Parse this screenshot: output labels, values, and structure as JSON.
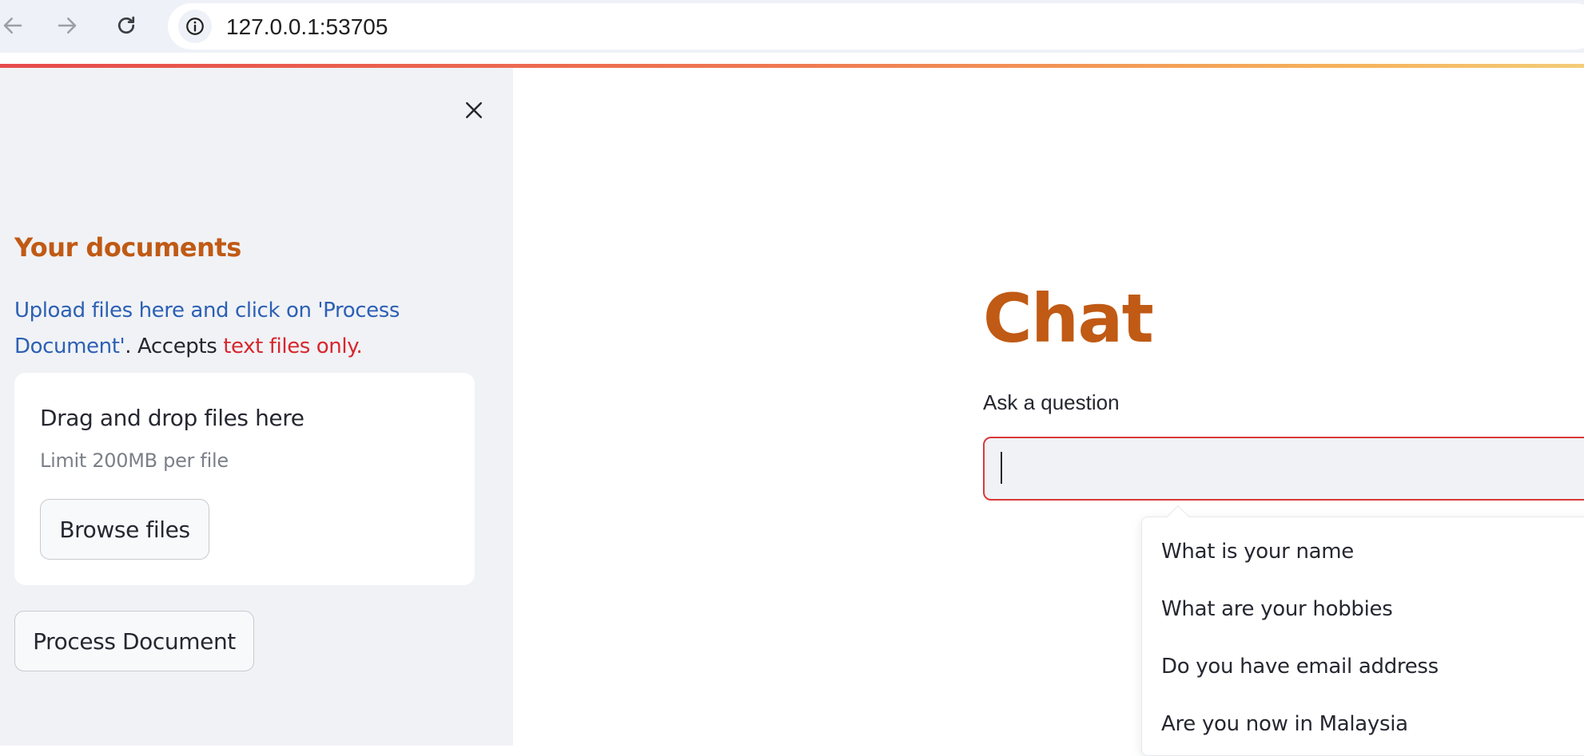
{
  "browser": {
    "url": "127.0.0.1:53705",
    "icons": {
      "back": "arrow-left-icon",
      "forward": "arrow-right-icon",
      "reload": "reload-icon",
      "site_info": "info-icon"
    }
  },
  "colors": {
    "accent": "#c05a14",
    "link_blue": "#2d60b4",
    "warning_red": "#d8262c",
    "sidebar_bg": "#f0f2f6",
    "input_border": "#d93a3a"
  },
  "sidebar": {
    "close_icon": "close-icon",
    "heading": "Your documents",
    "instructions": {
      "part1": "Upload files here and click on 'Process Document'",
      "part2": ". Accepts ",
      "part3": "text files only."
    },
    "uploader": {
      "title": "Drag and drop files here",
      "limit": "Limit 200MB per file",
      "browse_label": "Browse files"
    },
    "process_label": "Process Document"
  },
  "main": {
    "title": "Chat",
    "question_label": "Ask a question",
    "question_value": "",
    "suggestions": [
      "What is your name",
      "What are your hobbies",
      "Do you have email address",
      "Are you now in Malaysia"
    ]
  }
}
